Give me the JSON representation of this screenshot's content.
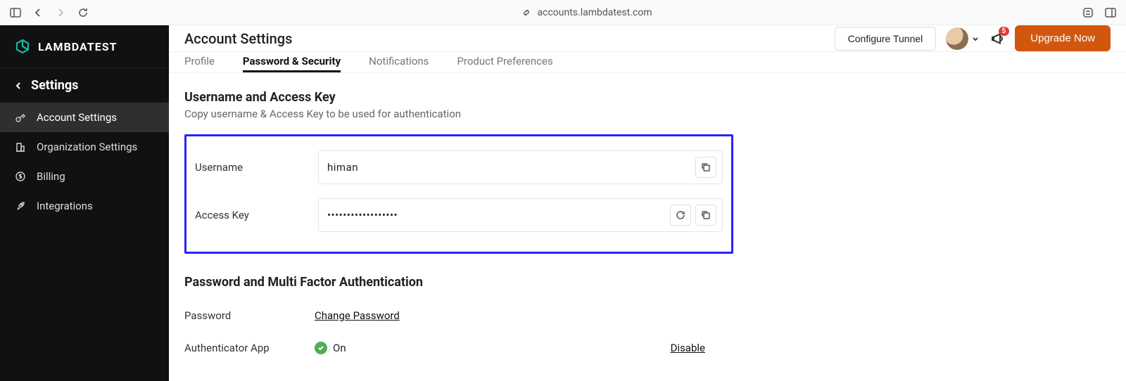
{
  "chrome": {
    "url": "accounts.lambdatest.com"
  },
  "brand": {
    "name": "LAMBDATEST"
  },
  "sidebar": {
    "header": "Settings",
    "items": [
      {
        "label": "Account Settings"
      },
      {
        "label": "Organization Settings"
      },
      {
        "label": "Billing"
      },
      {
        "label": "Integrations"
      }
    ]
  },
  "topbar": {
    "title": "Account Settings",
    "configure_tunnel": "Configure Tunnel",
    "upgrade": "Upgrade Now",
    "notification_count": "5"
  },
  "tabs": [
    {
      "label": "Profile"
    },
    {
      "label": "Password & Security"
    },
    {
      "label": "Notifications"
    },
    {
      "label": "Product Preferences"
    }
  ],
  "section1": {
    "title": "Username and Access Key",
    "subtitle": "Copy username & Access Key to be used for authentication",
    "username_label": "Username",
    "username_value": "himan",
    "accesskey_label": "Access Key",
    "accesskey_value": "••••••••••••••••••"
  },
  "section2": {
    "title": "Password and Multi Factor Authentication",
    "password_label": "Password",
    "change_password": "Change Password",
    "auth_app_label": "Authenticator App",
    "status_on": "On",
    "disable": "Disable"
  }
}
